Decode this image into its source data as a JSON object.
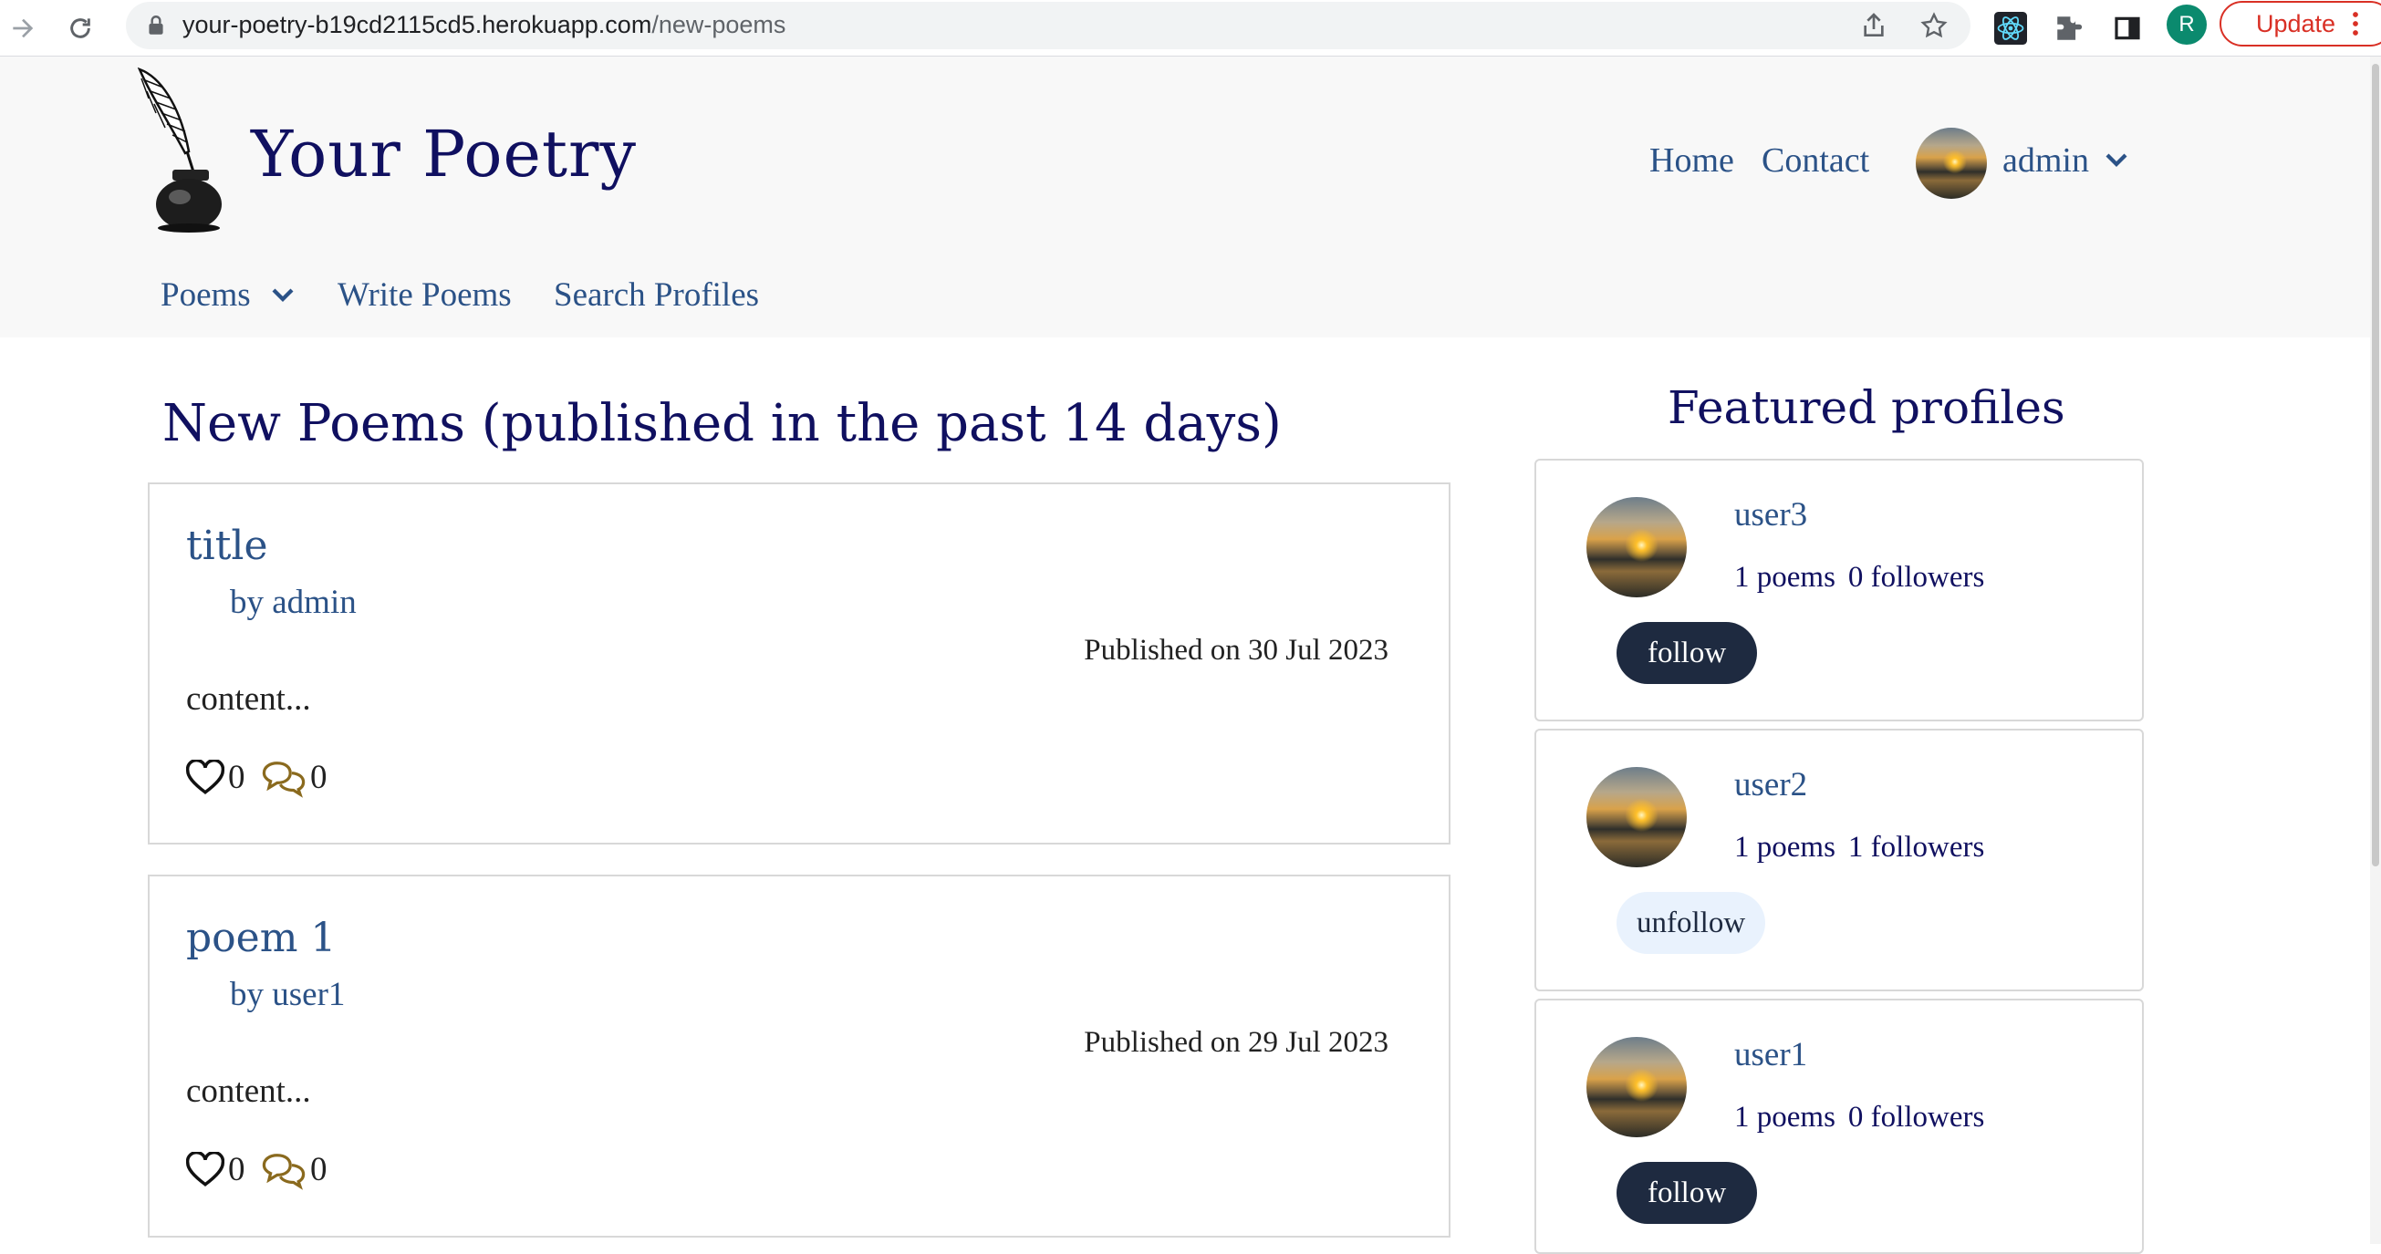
{
  "browser": {
    "url_domain": "your-poetry-b19cd2115cd5.herokuapp.com",
    "url_path": "/new-poems",
    "profile_initial": "R",
    "update_label": "Update"
  },
  "site": {
    "brand": "Your Poetry",
    "nav": {
      "home": "Home",
      "contact": "Contact"
    },
    "user": "admin",
    "subnav": {
      "poems": "Poems",
      "write": "Write Poems",
      "search": "Search Profiles"
    }
  },
  "main": {
    "title": "New Poems (published in the past 14 days)",
    "poems": [
      {
        "title": "title",
        "author": "by admin",
        "date": "Published on 30 Jul 2023",
        "excerpt": "content...",
        "likes": "0",
        "comments": "0"
      },
      {
        "title": "poem 1",
        "author": "by user1",
        "date": "Published on 29 Jul 2023",
        "excerpt": "content...",
        "likes": "0",
        "comments": "0"
      }
    ]
  },
  "featured": {
    "title": "Featured profiles",
    "profiles": [
      {
        "name": "user3",
        "poems": "1 poems",
        "followers": "0 followers",
        "button": "follow"
      },
      {
        "name": "user2",
        "poems": "1 poems",
        "followers": "1 followers",
        "button": "unfollow"
      },
      {
        "name": "user1",
        "poems": "1 poems",
        "followers": "0 followers",
        "button": "follow"
      }
    ]
  },
  "colors": {
    "accent": "#2b5287",
    "brand": "#101060",
    "button_dark": "#1e2a40",
    "button_light": "#e9f2fd",
    "comment_icon": "#8a6a1e"
  }
}
